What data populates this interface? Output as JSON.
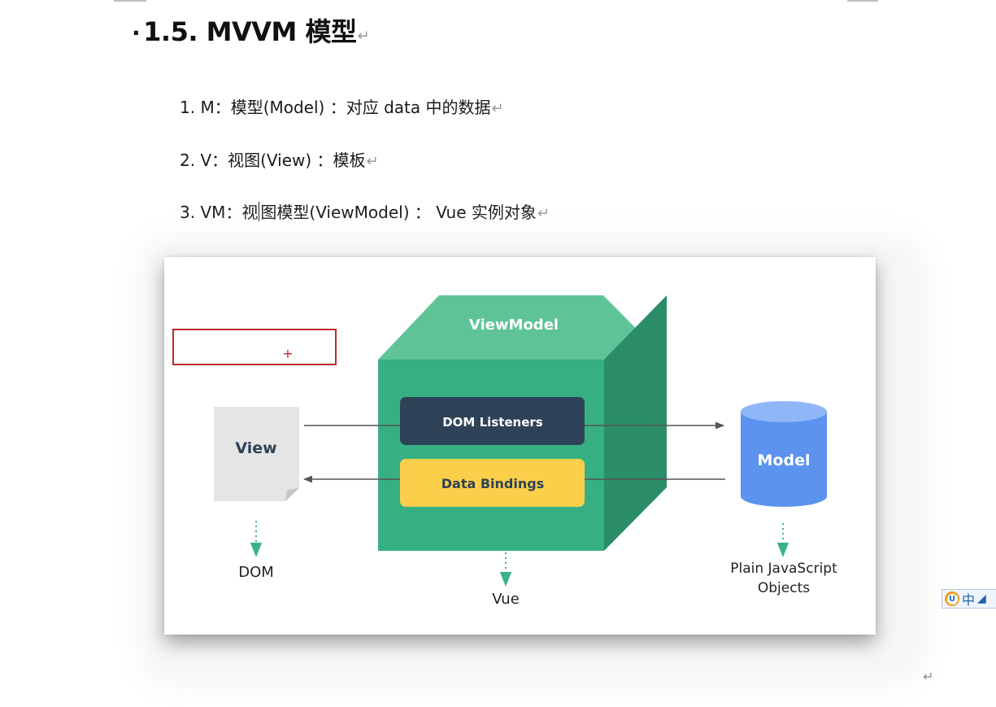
{
  "document": {
    "heading": {
      "bullet": "·",
      "text": "1.5. MVVM 模型",
      "paragraph_mark": "↵"
    },
    "list": [
      {
        "text": "1. M：模型(Model) ：对应 data 中的数据",
        "mark": "↵"
      },
      {
        "text": "2. V：视图(View) ：模板",
        "mark": "↵"
      },
      {
        "text_before_cursor": "3. VM：视",
        "text_after_cursor": "图模型(ViewModel) ：  Vue 实例对象",
        "mark": "↵"
      }
    ],
    "end_paragraph_mark": "↵"
  },
  "figure": {
    "view_label": "View",
    "viewmodel_label": "ViewModel",
    "dom_listeners_label": "DOM Listeners",
    "data_bindings_label": "Data Bindings",
    "model_label": "Model",
    "dom_caption": "DOM",
    "vue_caption": "Vue",
    "objects_caption_line1": "Plain JavaScript",
    "objects_caption_line2": "Objects",
    "selection_marker": "+",
    "colors": {
      "cube_front": "#36b083",
      "cube_top": "#5ec497",
      "cube_side": "#2a8d67",
      "dom_listeners_bg": "#2e4257",
      "data_bindings_bg": "#fccf4a",
      "model_body": "#5b93ef",
      "model_top": "#8fb7f7",
      "selection_border": "#c0282d",
      "arrow": "#555555",
      "dashed_arrow": "#3bb38a"
    }
  },
  "ime_toolbar": {
    "logo": "U",
    "mode": "中",
    "punct_icon": "moon-icon"
  }
}
